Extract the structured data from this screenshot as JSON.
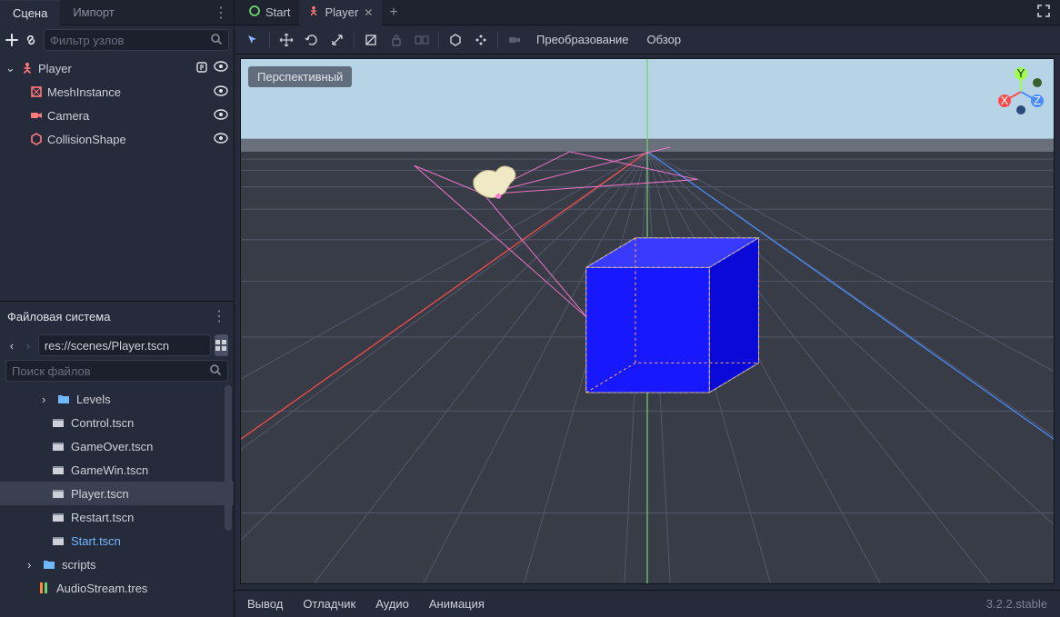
{
  "scene_panel": {
    "tabs": {
      "scene": "Сцена",
      "import": "Импорт"
    },
    "filter_placeholder": "Фильтр узлов",
    "nodes": {
      "root": "Player",
      "children": [
        "MeshInstance",
        "Camera",
        "CollisionShape"
      ]
    }
  },
  "filesystem_panel": {
    "title": "Файловая система",
    "path": "res://scenes/Player.tscn",
    "search_placeholder": "Поиск файлов",
    "items": [
      {
        "kind": "folder",
        "label": "Levels",
        "indent": 2,
        "arrow": ">"
      },
      {
        "kind": "scene",
        "label": "Control.tscn",
        "indent": 2
      },
      {
        "kind": "scene",
        "label": "GameOver.tscn",
        "indent": 2
      },
      {
        "kind": "scene",
        "label": "GameWin.tscn",
        "indent": 2
      },
      {
        "kind": "scene",
        "label": "Player.tscn",
        "indent": 2,
        "selected": true
      },
      {
        "kind": "scene",
        "label": "Restart.tscn",
        "indent": 2
      },
      {
        "kind": "scene",
        "label": "Start.tscn",
        "indent": 2,
        "blue": true
      },
      {
        "kind": "folder",
        "label": "scripts",
        "indent": 1,
        "arrow": ">"
      },
      {
        "kind": "res",
        "label": "AudioStream.tres",
        "indent": 1
      }
    ]
  },
  "main": {
    "tabs": [
      {
        "label": "Start",
        "icon": "circle"
      },
      {
        "label": "Player",
        "icon": "player",
        "active": true
      }
    ],
    "viewport_toolbar": {
      "transform": "Преобразование",
      "view": "Обзор"
    },
    "perspective_label": "Перспективный",
    "axes": {
      "x": "X",
      "y": "Y",
      "z": "Z"
    }
  },
  "bottom_bar": {
    "output": "Вывод",
    "debugger": "Отладчик",
    "audio": "Аудио",
    "animation": "Анимация",
    "version": "3.2.2.stable"
  }
}
